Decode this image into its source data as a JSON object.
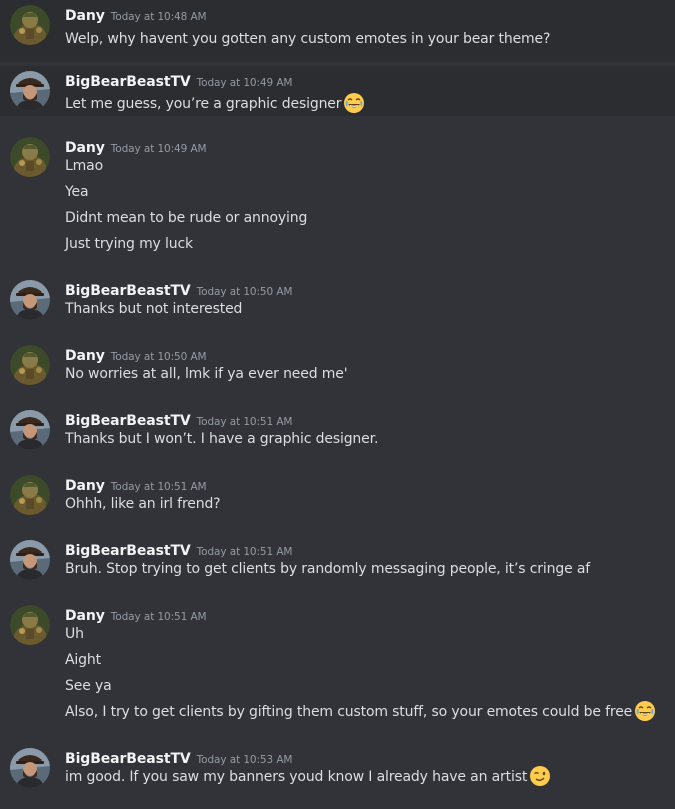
{
  "colors": {
    "background": "#313338",
    "highlight_row": "#2b2d31",
    "username": "#f2f3f5",
    "timestamp": "#949ba4",
    "message_text": "#dbdee1"
  },
  "messages": [
    {
      "author": "Dany",
      "timestamp": "Today at 10:48 AM",
      "avatar_icon": "dany-avatar",
      "lines": [
        {
          "text": "Welp, why havent you gotten any custom emotes in your bear theme?"
        }
      ]
    },
    {
      "author": "BigBearBeastTV",
      "timestamp": "Today at 10:49 AM",
      "avatar_icon": "bigbear-avatar",
      "lines": [
        {
          "text": "Let me guess, you’re a graphic designer",
          "emoji": "joy-emoji"
        }
      ]
    },
    {
      "author": "Dany",
      "timestamp": "Today at 10:49 AM",
      "avatar_icon": "dany-avatar",
      "lines": [
        {
          "text": "Lmao"
        },
        {
          "text": "Yea"
        },
        {
          "text": "Didnt mean to be rude or annoying"
        },
        {
          "text": "Just trying my luck"
        }
      ]
    },
    {
      "author": "BigBearBeastTV",
      "timestamp": "Today at 10:50 AM",
      "avatar_icon": "bigbear-avatar",
      "lines": [
        {
          "text": "Thanks but not interested"
        }
      ]
    },
    {
      "author": "Dany",
      "timestamp": "Today at 10:50 AM",
      "avatar_icon": "dany-avatar",
      "lines": [
        {
          "text": "No worries at all, lmk if ya ever need me'"
        }
      ]
    },
    {
      "author": "BigBearBeastTV",
      "timestamp": "Today at 10:51 AM",
      "avatar_icon": "bigbear-avatar",
      "lines": [
        {
          "text": "Thanks but I won’t. I have a graphic designer."
        }
      ]
    },
    {
      "author": "Dany",
      "timestamp": "Today at 10:51 AM",
      "avatar_icon": "dany-avatar",
      "lines": [
        {
          "text": "Ohhh, like an irl frend?"
        }
      ]
    },
    {
      "author": "BigBearBeastTV",
      "timestamp": "Today at 10:51 AM",
      "avatar_icon": "bigbear-avatar",
      "lines": [
        {
          "text": "Bruh. Stop trying to get clients by randomly messaging people, it’s cringe af"
        }
      ]
    },
    {
      "author": "Dany",
      "timestamp": "Today at 10:51 AM",
      "avatar_icon": "dany-avatar",
      "lines": [
        {
          "text": "Uh"
        },
        {
          "text": "Aight"
        },
        {
          "text": "See ya"
        },
        {
          "text": "Also, I try to get clients by gifting them custom stuff, so your emotes could be free",
          "emoji": "joy-emoji"
        }
      ]
    },
    {
      "author": "BigBearBeastTV",
      "timestamp": "Today at 10:53 AM",
      "avatar_icon": "bigbear-avatar",
      "lines": [
        {
          "text": "im good. If you saw my banners youd know I already have an artist",
          "emoji": "wink-emoji"
        }
      ]
    }
  ]
}
